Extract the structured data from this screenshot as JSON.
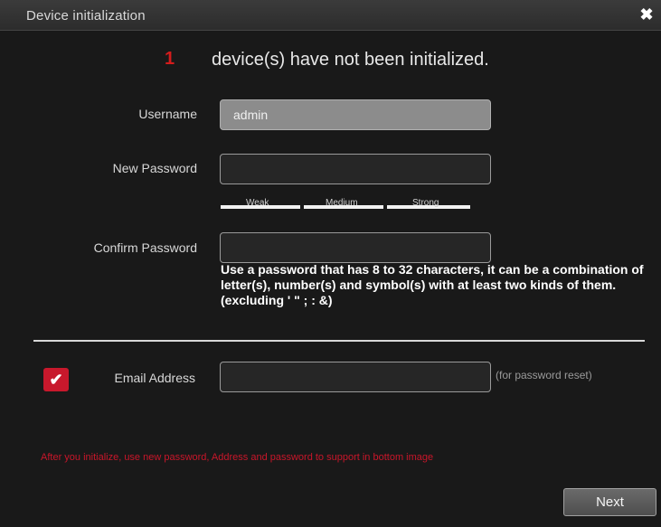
{
  "window": {
    "title": "Device initialization",
    "close_symbol": "✖"
  },
  "status": {
    "count": "1",
    "message": "device(s) have not been initialized."
  },
  "form": {
    "username_label": "Username",
    "username_value": "admin",
    "new_password_label": "New Password",
    "new_password_value": "",
    "strength_labels": [
      "Weak",
      "Medium",
      "Strong"
    ],
    "confirm_password_label": "Confirm Password",
    "confirm_password_value": "",
    "password_hint": "Use a password that has 8 to 32 characters, it can be a combination of letter(s), number(s) and symbol(s) with at least two kinds of them. (excluding ' \" ; : &)",
    "email_label": "Email Address",
    "email_checked": true,
    "email_value": "",
    "email_note": "(for password reset)"
  },
  "warning_text": "After you initialize, use new password, Address and password to support in bottom image",
  "buttons": {
    "next_label": "Next"
  },
  "colors": {
    "accent_red": "#c8182c",
    "background": "#191919",
    "titlebar": "#2c2c2c"
  }
}
